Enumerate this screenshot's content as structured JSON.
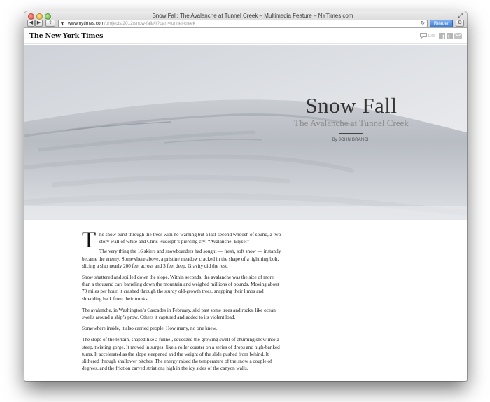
{
  "window": {
    "title": "Snow Fall: The Avalanche at Tunnel Creek – Multimedia Feature – NYTimes.com"
  },
  "toolbar": {
    "back_label": "◀",
    "forward_label": "▶",
    "share_label": "⇪",
    "url_host": "www.nytimes.com",
    "url_path": "/projects/2012/snow-fall/#/?part=tunnel-creek",
    "reader_label": "Reader",
    "settings_icon": "⚙"
  },
  "site": {
    "logo": "The New York Times",
    "comment_count": "1166",
    "icons": [
      "comment-icon",
      "facebook-icon",
      "twitter-icon",
      "email-icon"
    ]
  },
  "hero": {
    "title": "Snow Fall",
    "subtitle": "The Avalanche at Tunnel Creek",
    "byline": "By JOHN BRANCH"
  },
  "article": {
    "dropcap": "T",
    "paragraphs": [
      "he snow burst through the trees with no warning but a last-second whoosh of sound, a two-story wall of white and Chris Rudolph’s piercing cry: “Avalanche! Elyse!”",
      "The very thing the 16 skiers and snowboarders had sought — fresh, soft snow — instantly became the enemy. Somewhere above, a pristine meadow cracked in the shape of a lightning bolt, slicing a slab nearly 200 feet across and 3 feet deep. Gravity did the rest.",
      "Snow shattered and spilled down the slope. Within seconds, the avalanche was the size of more than a thousand cars barreling down the mountain and weighed millions of pounds. Moving about 70 miles per hour, it crashed through the sturdy old-growth trees, snapping their limbs and shredding bark from their trunks.",
      "The avalanche, in Washington’s Cascades in February, slid past some trees and rocks, like ocean swells around a ship’s prow. Others it captured and added to its violent load.",
      "Somewhere inside, it also carried people. How many, no one knew.",
      "The slope of the terrain, shaped like a funnel, squeezed the growing swell of churning snow into a steep, twisting gorge. It moved in surges, like a roller coaster on a series of drops and high-banked turns. It accelerated as the slope steepened and the weight of the slide pushed from behind. It slithered through shallower pitches. The energy raised the temperature of the snow a couple of degrees, and the friction carved striations high in the icy sides of the canyon walls."
    ]
  }
}
